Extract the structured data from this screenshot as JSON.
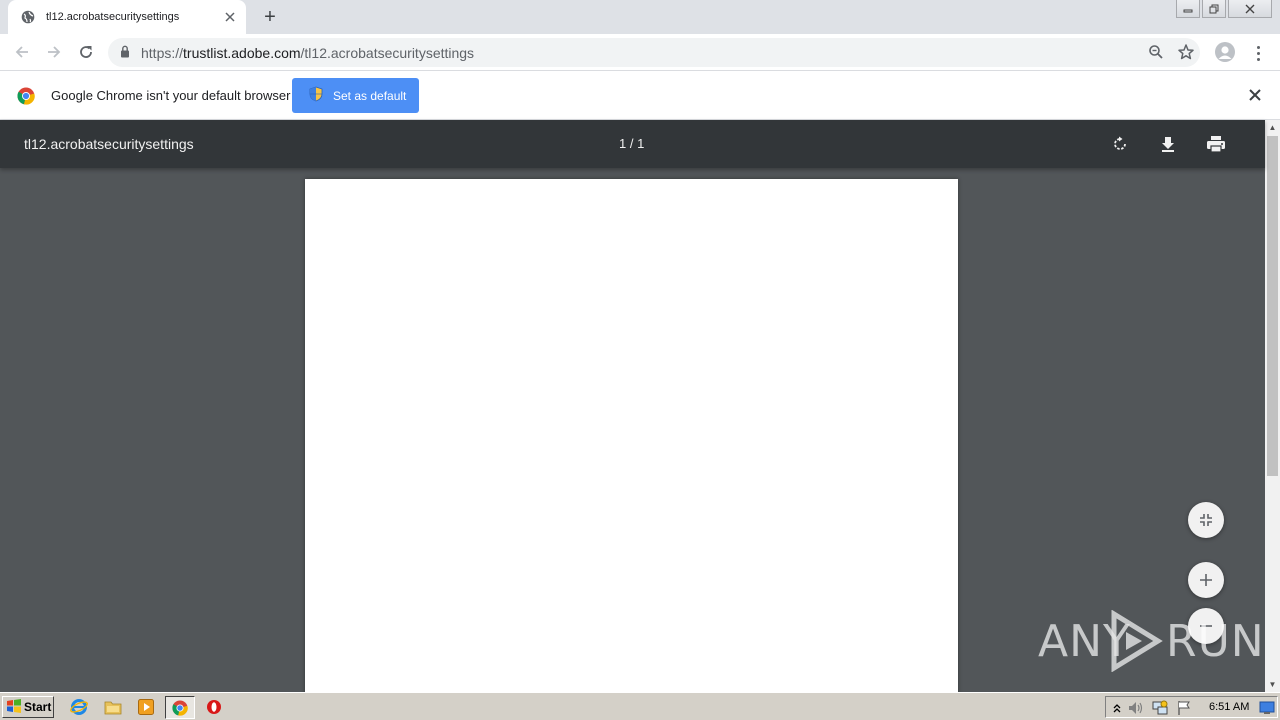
{
  "browser": {
    "tab_title": "tl12.acrobatsecuritysettings",
    "new_tab_label": "+",
    "url_scheme": "https://",
    "url_host": "trustlist.adobe.com",
    "url_path": "/tl12.acrobatsecuritysettings"
  },
  "infobar": {
    "message": "Google Chrome isn't your default browser",
    "button_label": "Set as default"
  },
  "pdf": {
    "title": "tl12.acrobatsecuritysettings",
    "page_count": "1 / 1"
  },
  "watermark": {
    "text_left": "ANY",
    "text_right": "RUN"
  },
  "taskbar": {
    "start_label": "Start",
    "clock": "6:51 AM"
  },
  "colors": {
    "accent_blue": "#4d8ff5",
    "pdf_toolbar": "#323639",
    "pdf_background": "#525659"
  }
}
